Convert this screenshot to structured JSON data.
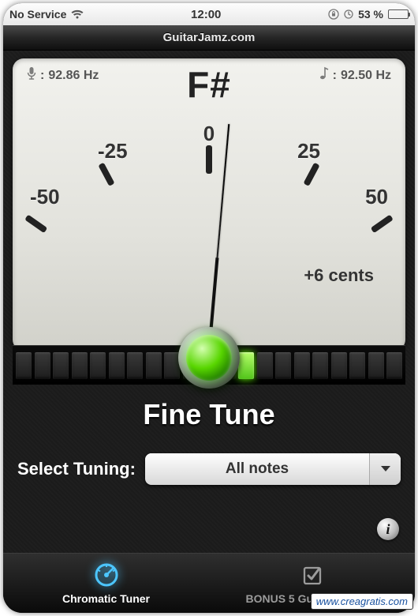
{
  "status": {
    "carrier": "No Service",
    "time": "12:00",
    "battery_pct": "53 %"
  },
  "nav": {
    "title": "GuitarJamz.com"
  },
  "meter": {
    "mic_hz_prefix": ":",
    "mic_hz": "92.86 Hz",
    "target_note": "F#",
    "ref_hz_prefix": ":",
    "ref_hz": "92.50 Hz",
    "scale": {
      "m50": "-50",
      "m25": "-25",
      "zero": "0",
      "p25": "25",
      "p50": "50"
    },
    "cents_readout": "+6 cents"
  },
  "fine_tune_label": "Fine Tune",
  "tuning": {
    "label": "Select Tuning:",
    "selected": "All notes"
  },
  "tabs": {
    "chromatic": "Chromatic Tuner",
    "bonus": "BONUS 5 Guitar Lessons"
  },
  "watermark": "www.creagratis.com"
}
